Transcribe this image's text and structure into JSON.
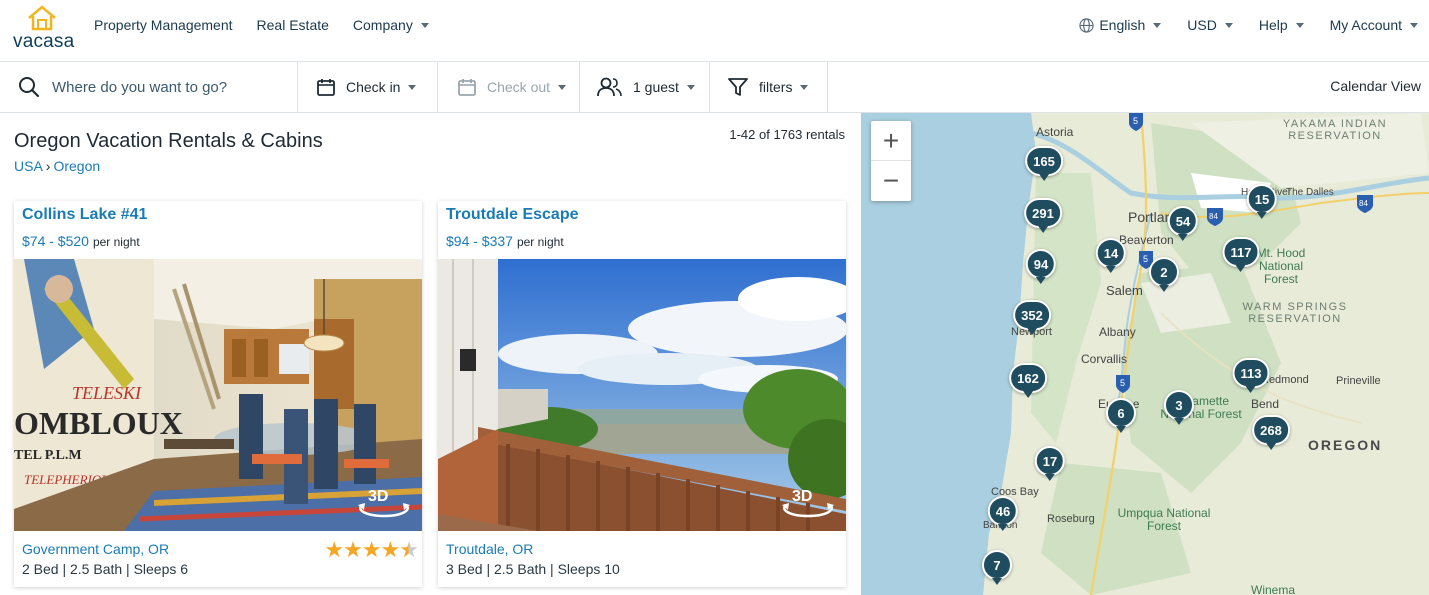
{
  "brand": {
    "name": "vacasa"
  },
  "topnav": {
    "left": [
      "Property Management",
      "Real Estate",
      "Company"
    ],
    "language": "English",
    "currency": "USD",
    "help": "Help",
    "account": "My Account"
  },
  "search": {
    "placeholder": "Where do you want to go?",
    "checkin": "Check in",
    "checkout": "Check out",
    "guests": "1 guest",
    "filters": "filters",
    "calendar_view": "Calendar View"
  },
  "results": {
    "title": "Oregon Vacation Rentals & Cabins",
    "breadcrumb": [
      "USA",
      "Oregon"
    ],
    "count": "1-42 of 1763 rentals"
  },
  "listings": [
    {
      "title": "Collins Lake #41",
      "price": "$74 - $520",
      "per": "per night",
      "location": "Government Camp, OR",
      "specs": "2 Bed | 2.5 Bath | Sleeps 6",
      "rating": 4.5,
      "badge": "3D"
    },
    {
      "title": "Troutdale Escape",
      "price": "$94 - $337",
      "per": "per night",
      "location": "Troutdale, OR",
      "specs": "3 Bed | 2.5 Bath | Sleeps 10",
      "badge": "3D"
    }
  ],
  "map": {
    "zoom_in": "+",
    "zoom_out": "−",
    "clusters": [
      "165",
      "291",
      "54",
      "15",
      "14",
      "117",
      "94",
      "2",
      "352",
      "162",
      "113",
      "3",
      "6",
      "268",
      "17",
      "46",
      "7"
    ],
    "labels": {
      "astoria": "Astoria",
      "portland": "Portland",
      "beaverton": "Beaverton",
      "salem": "Salem",
      "albany": "Albany",
      "corvallis": "Corvallis",
      "newport": "Newport",
      "eugene": "Eugene",
      "bend": "Bend",
      "redmond": "Redmond",
      "prineville": "Prineville",
      "coosbay": "Coos Bay",
      "bandon": "Bandon",
      "roseburg": "Roseburg",
      "hoodriver": "Hood River",
      "thedalles": "The Dalles",
      "yakama": "YAKAMA INDIAN RESERVATION",
      "warmsprings": "WARM SPRINGS RESERVATION",
      "mthood": "Mt. Hood National Forest",
      "willamette": "Willamette National Forest",
      "umpqua": "Umpqua National Forest",
      "winema": "Winema",
      "oregon": "OREGON",
      "i5": "5",
      "i84": "84"
    }
  },
  "colors": {
    "accent": "#1b7bb4",
    "pin": "#1f4c5f",
    "star": "#f5a623",
    "logo": "#f2b51d"
  }
}
